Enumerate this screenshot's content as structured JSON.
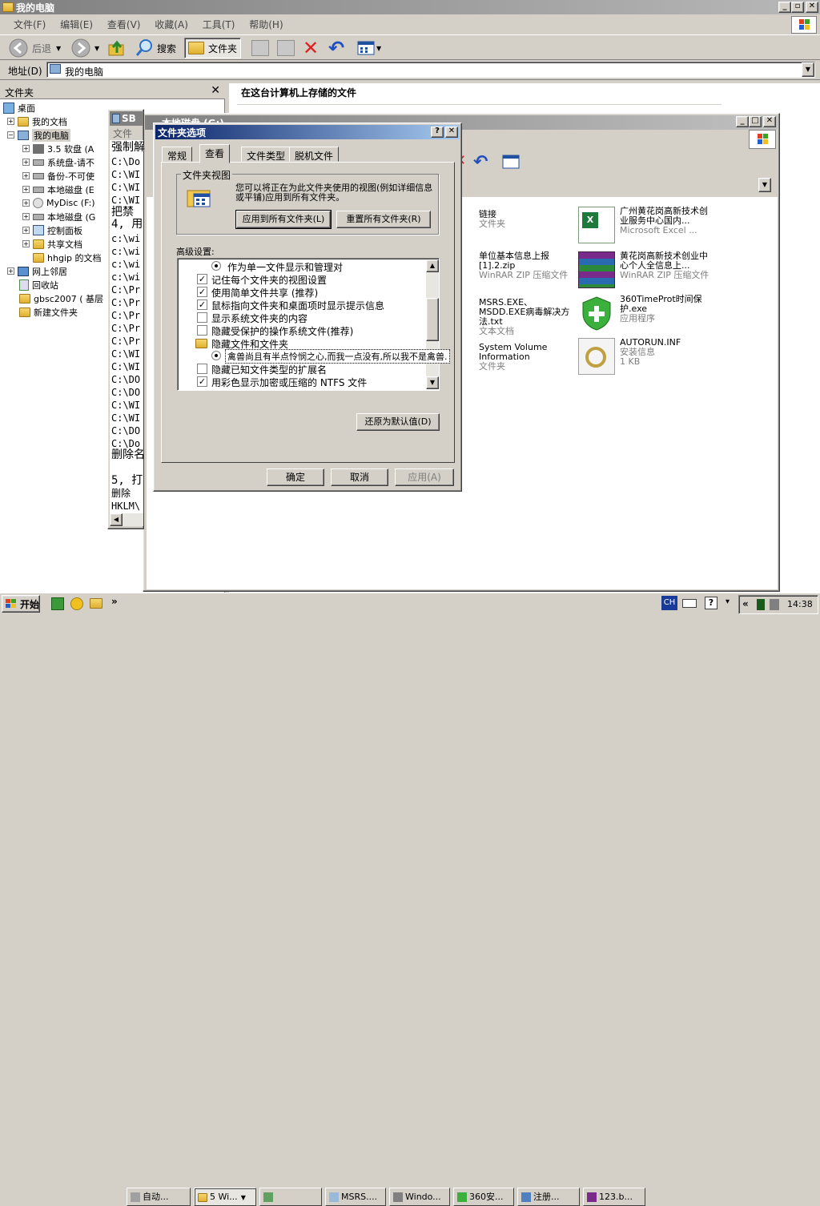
{
  "main_window": {
    "title": "我的电脑",
    "menu": [
      "文件(F)",
      "编辑(E)",
      "查看(V)",
      "收藏(A)",
      "工具(T)",
      "帮助(H)"
    ],
    "toolbar": {
      "back": "后退",
      "search": "搜索",
      "folders": "文件夹"
    },
    "address_label": "地址(D)",
    "address_value": "我的电脑",
    "folders_pane_title": "文件夹",
    "right_pane_heading": "在这台计算机上存储的文件"
  },
  "tree": [
    {
      "label": "桌面"
    },
    {
      "label": "我的文档"
    },
    {
      "label": "我的电脑"
    },
    {
      "label": "3.5 软盘 (A"
    },
    {
      "label": "系统盘-请不"
    },
    {
      "label": "备份-不可使"
    },
    {
      "label": "本地磁盘 (E"
    },
    {
      "label": "MyDisc (F:)"
    },
    {
      "label": "本地磁盘 (G"
    },
    {
      "label": "控制面板"
    },
    {
      "label": "共享文档"
    },
    {
      "label": "hhgip 的文档"
    },
    {
      "label": "网上邻居"
    },
    {
      "label": "回收站"
    },
    {
      "label": "gbsc2007 ( 基层"
    },
    {
      "label": "新建文件夹"
    }
  ],
  "cmd_window": {
    "title": "SB",
    "menu_first": "文件",
    "lines": [
      "强制解",
      "C:\\Do",
      "C:\\WI",
      "C:\\WI",
      "C:\\WI",
      "把禁",
      "4, 用",
      "c:\\wi",
      "c:\\wi",
      "c:\\wi",
      "c:\\wi",
      "C:\\Pr",
      "C:\\Pr",
      "C:\\Pr",
      "C:\\Pr",
      "C:\\Pr",
      "C:\\WI",
      "C:\\WI",
      "C:\\DO",
      "C:\\DO",
      "C:\\WI",
      "C:\\WI",
      "C:\\DO",
      "C:\\Do",
      "删除名",
      "",
      "5, 打",
      "删除",
      "HKLM\\"
    ]
  },
  "explorer2": {
    "title": "本地磁盘 (G:)",
    "items": [
      {
        "name": "链接",
        "sub": "文件夹"
      },
      {
        "name": "广州黄花岗高新技术创业服务中心国内...",
        "sub": "Microsoft Excel ..."
      },
      {
        "name": "单位基本信息上报[1].2.zip",
        "sub": "WinRAR ZIP 压缩文件"
      },
      {
        "name": "黄花岗高新技术创业中心个人全信息上...",
        "sub": "WinRAR ZIP 压缩文件"
      },
      {
        "name": "MSRS.EXE、MSDD.EXE病毒解决方法.txt",
        "sub": "文本文档"
      },
      {
        "name": "360TimeProt时间保护.exe",
        "sub": "应用程序"
      },
      {
        "name": "System Volume Information",
        "sub": "文件夹"
      },
      {
        "name": "AUTORUN.INF",
        "sub": "安装信息"
      },
      {
        "name": "",
        "sub": "1 KB"
      }
    ]
  },
  "dialog": {
    "title": "文件夹选项",
    "help_btn": "?",
    "close_btn": "✕",
    "tabs": [
      "常规",
      "查看",
      "文件类型",
      "脱机文件"
    ],
    "group_title": "文件夹视图",
    "group_desc": "您可以将正在为此文件夹使用的视图(例如详细信息或平铺)应用到所有文件夹。",
    "apply_all": "应用到所有文件夹(L)",
    "reset_all": "重置所有文件夹(R)",
    "advanced_label": "高级设置:",
    "advanced": [
      {
        "type": "radio",
        "label": "作为单一文件显示和管理对"
      },
      {
        "type": "check",
        "checked": true,
        "label": "记住每个文件夹的视图设置"
      },
      {
        "type": "check",
        "checked": true,
        "label": "使用简单文件共享 (推荐)"
      },
      {
        "type": "check",
        "checked": true,
        "label": "鼠标指向文件夹和桌面项时显示提示信息"
      },
      {
        "type": "check",
        "checked": false,
        "label": "显示系统文件夹的内容"
      },
      {
        "type": "check",
        "checked": false,
        "label": "隐藏受保护的操作系统文件(推荐)"
      },
      {
        "type": "folder",
        "label": "隐藏文件和文件夹"
      },
      {
        "type": "radio",
        "label": "禽兽尚且有半点怜悯之心,而我一点没有,所以我不是禽兽."
      },
      {
        "type": "check",
        "checked": false,
        "label": "隐藏已知文件类型的扩展名"
      },
      {
        "type": "check",
        "checked": true,
        "label": "用彩色显示加密或压缩的 NTFS 文件"
      }
    ],
    "restore_defaults": "还原为默认值(D)",
    "ok": "确定",
    "cancel": "取消",
    "apply": "应用(A)"
  },
  "taskbar": {
    "start": "开始",
    "quick_more": "»",
    "tasks": [
      "自动...",
      "5 Wi...",
      "",
      "MSRS....",
      "Windo...",
      "360安...",
      "注册...",
      "123.b..."
    ],
    "ime": "CH",
    "tray_more": "«",
    "clock": "14:38"
  }
}
